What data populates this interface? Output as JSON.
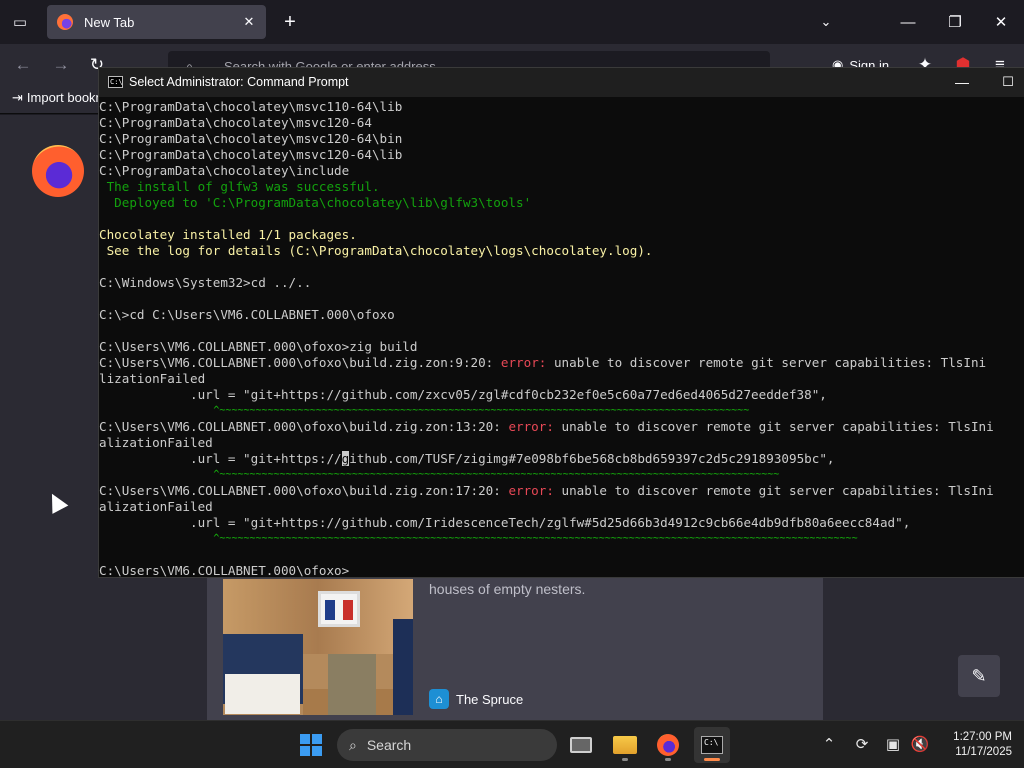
{
  "browser": {
    "tab_title": "New Tab",
    "url_placeholder": "Search with Google or enter address",
    "sign_in_label": "Sign in",
    "import_bookmarks_label": "Import bookmarks"
  },
  "ntp": {
    "story_excerpt": "houses of empty nesters.",
    "story_source": "The Spruce"
  },
  "cmd": {
    "title": "Select Administrator: Command Prompt",
    "lines": [
      [
        "C:\\ProgramData\\chocolatey\\msvc110-64\\lib"
      ],
      [
        "C:\\ProgramData\\chocolatey\\msvc120-64"
      ],
      [
        "C:\\ProgramData\\chocolatey\\msvc120-64\\bin"
      ],
      [
        "C:\\ProgramData\\chocolatey\\msvc120-64\\lib"
      ],
      [
        "C:\\ProgramData\\chocolatey\\include"
      ],
      [
        " The install of glfw3 was successful."
      ],
      [
        "  Deployed to 'C:\\ProgramData\\chocolatey\\lib\\glfw3\\tools'"
      ],
      [
        ""
      ],
      [
        "Chocolatey installed 1/1 packages."
      ],
      [
        " See the log for details (C:\\ProgramData\\chocolatey\\logs\\chocolatey.log)."
      ],
      [
        ""
      ],
      [
        "C:\\Windows\\System32>cd ../.."
      ],
      [
        ""
      ],
      [
        "C:\\>cd C:\\Users\\VM6.COLLABNET.000\\ofoxo"
      ],
      [
        ""
      ],
      [
        "C:\\Users\\VM6.COLLABNET.000\\ofoxo>zig build"
      ],
      [
        "C:\\Users\\VM6.COLLABNET.000\\ofoxo\\build.zig.zon:9:20: ",
        "error:",
        " unable to discover remote git server capabilities: TlsIni"
      ],
      [
        "lizationFailed"
      ],
      [
        "            .url = \"git+https://github.com/zxcv05/zgl#cdf0cb232ef0e5c60a77ed6ed4065d27eeddef38\","
      ],
      [
        "                   ^~~~~~~~~~~~~~~~~~~~~~~~~~~~~~~~~~~~~~~~~~~~~~~~~~~~~~~~~~~~~~~~~~~~~~~~~~~~~~~~~~~~~~~~~"
      ],
      [
        "C:\\Users\\VM6.COLLABNET.000\\ofoxo\\build.zig.zon:13:20: ",
        "error:",
        " unable to discover remote git server capabilities: TlsIni"
      ],
      [
        "alizationFailed"
      ],
      [
        "            .url = \"git+https://",
        "g",
        "ithub.com/TUSF/zigimg#7e098bf6be568cb8bd659397c2d5c291893095bc\","
      ],
      [
        "                   ^~~~~~~~~~~~~~~~~~~~~~~~~~~~~~~~~~~~~~~~~~~~~~~~~~~~~~~~~~~~~~~~~~~~~~~~~~~~~~~~~~~~~~~~~~~~~~"
      ],
      [
        "C:\\Users\\VM6.COLLABNET.000\\ofoxo\\build.zig.zon:17:20: ",
        "error:",
        " unable to discover remote git server capabilities: TlsIni"
      ],
      [
        "alizationFailed"
      ],
      [
        "            .url = \"git+https://github.com/IridescenceTech/zglfw#5d25d66b3d4912c9cb66e4db9dfb80a6eecc84ad\","
      ],
      [
        "                   ^~~~~~~~~~~~~~~~~~~~~~~~~~~~~~~~~~~~~~~~~~~~~~~~~~~~~~~~~~~~~~~~~~~~~~~~~~~~~~~~~~~~~~~~~~~~~~~~~~~~~~~~~~~"
      ],
      [
        ""
      ],
      [
        "C:\\Users\\VM6.COLLABNET.000\\ofoxo>"
      ]
    ]
  },
  "taskbar": {
    "search_label": "Search",
    "time": "1:27:00 PM",
    "date": "11/17/2025"
  },
  "colors": {
    "accent": "#ff8a4a",
    "terminal_green": "#13a10e",
    "terminal_yellow": "#f9f1a5",
    "terminal_red": "#e74856"
  },
  "icons": [
    "firefox-view-icon",
    "close-icon",
    "plus-icon",
    "chevron-down-icon",
    "minimize-icon",
    "maximize-icon",
    "back-icon",
    "forward-icon",
    "reload-icon",
    "search-icon",
    "account-icon",
    "extensions-icon",
    "menu-icon",
    "import-icon",
    "edit-icon",
    "windows-logo-icon",
    "task-view-icon",
    "file-explorer-icon",
    "firefox-icon",
    "terminal-icon",
    "network-icon",
    "volume-icon"
  ]
}
